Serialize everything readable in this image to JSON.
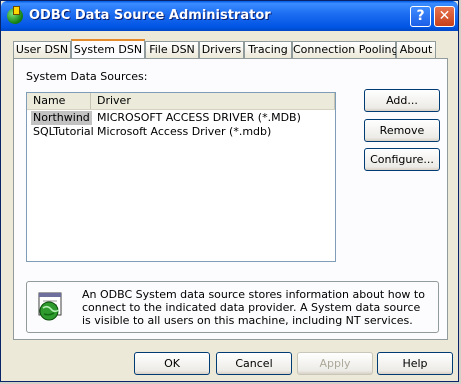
{
  "window": {
    "title": "ODBC Data Source Administrator",
    "help_glyph": "?",
    "close_glyph": "✕"
  },
  "tabs": [
    {
      "label": "User DSN"
    },
    {
      "label": "System DSN"
    },
    {
      "label": "File DSN"
    },
    {
      "label": "Drivers"
    },
    {
      "label": "Tracing"
    },
    {
      "label": "Connection Pooling"
    },
    {
      "label": "About"
    }
  ],
  "panel": {
    "label": "System Data Sources:",
    "columns": [
      "Name",
      "Driver"
    ],
    "rows": [
      {
        "name": "Northwind",
        "driver": "MICROSOFT ACCESS DRIVER (*.MDB)"
      },
      {
        "name": "SQLTutorial",
        "driver": "Microsoft Access Driver (*.mdb)"
      }
    ],
    "buttons": {
      "add": "Add...",
      "remove": "Remove",
      "configure": "Configure..."
    },
    "info": "An ODBC System data source stores information about how to connect to the indicated data provider.  A System data source is visible to all users on this machine, including NT services."
  },
  "footer": {
    "ok": "OK",
    "cancel": "Cancel",
    "apply": "Apply",
    "help": "Help"
  }
}
